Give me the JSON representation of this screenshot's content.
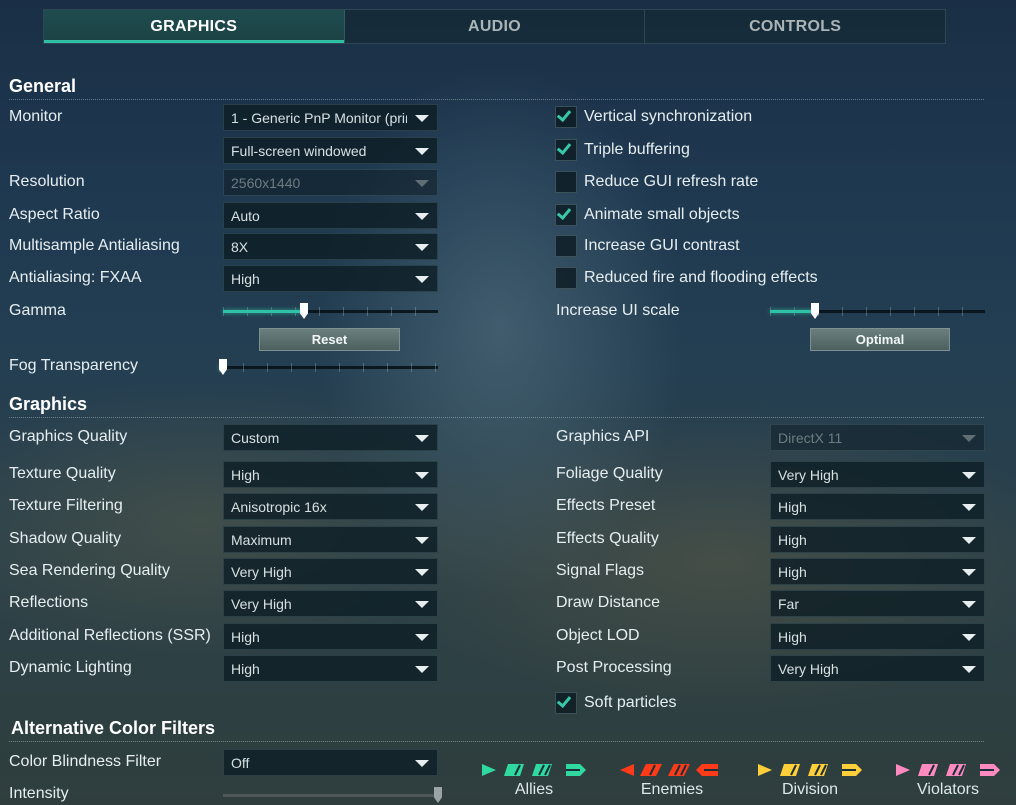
{
  "tabs": [
    {
      "label": "GRAPHICS",
      "active": true
    },
    {
      "label": "AUDIO",
      "active": false
    },
    {
      "label": "CONTROLS",
      "active": false
    }
  ],
  "general": {
    "heading": "General",
    "monitor_label": "Monitor",
    "monitor_value": "1 - Generic PnP Monitor (prim",
    "mode_value": "Full-screen windowed",
    "resolution_label": "Resolution",
    "resolution_value": "2560x1440",
    "aspect_label": "Aspect Ratio",
    "aspect_value": "Auto",
    "msaa_label": "Multisample Antialiasing",
    "msaa_value": "8X",
    "fxaa_label": "Antialiasing: FXAA",
    "fxaa_value": "High",
    "gamma_label": "Gamma",
    "gamma_level": 0.37,
    "reset_label": "Reset",
    "fog_label": "Fog Transparency",
    "fog_level": 0.0,
    "checkboxes": [
      {
        "label": "Vertical synchronization",
        "checked": true
      },
      {
        "label": "Triple buffering",
        "checked": true
      },
      {
        "label": "Reduce GUI refresh rate",
        "checked": false
      },
      {
        "label": "Animate small objects",
        "checked": true
      },
      {
        "label": "Increase GUI contrast",
        "checked": false
      },
      {
        "label": "Reduced fire and flooding effects",
        "checked": false
      }
    ],
    "ui_scale_label": "Increase UI scale",
    "ui_scale_level": 0.2,
    "optimal_label": "Optimal"
  },
  "graphics": {
    "heading": "Graphics",
    "left": [
      {
        "label": "Graphics Quality",
        "value": "Custom"
      },
      {
        "label": "Texture Quality",
        "value": "High"
      },
      {
        "label": "Texture Filtering",
        "value": "Anisotropic 16x"
      },
      {
        "label": "Shadow Quality",
        "value": "Maximum"
      },
      {
        "label": "Sea Rendering Quality",
        "value": "Very High"
      },
      {
        "label": "Reflections",
        "value": "Very High"
      },
      {
        "label": "Additional Reflections (SSR)",
        "value": "High"
      },
      {
        "label": "Dynamic Lighting",
        "value": "High"
      }
    ],
    "right": [
      {
        "label": "Graphics API",
        "value": "DirectX 11"
      },
      {
        "label": "Foliage Quality",
        "value": "Very High"
      },
      {
        "label": "Effects Preset",
        "value": "High"
      },
      {
        "label": "Effects Quality",
        "value": "High"
      },
      {
        "label": "Signal Flags",
        "value": "High"
      },
      {
        "label": "Draw Distance",
        "value": "Far"
      },
      {
        "label": "Object LOD",
        "value": "High"
      },
      {
        "label": "Post Processing",
        "value": "Very High"
      }
    ],
    "soft_particles_label": "Soft particles",
    "soft_particles_checked": true
  },
  "color_filters": {
    "heading": "Alternative Color Filters",
    "filter_label": "Color Blindness Filter",
    "filter_value": "Off",
    "intensity_label": "Intensity",
    "intensity_level": 1.0,
    "groups": [
      {
        "label": "Allies",
        "color": "#2fd9a0"
      },
      {
        "label": "Enemies",
        "color": "#ff3a18"
      },
      {
        "label": "Division",
        "color": "#ffcf3a"
      },
      {
        "label": "Violators",
        "color": "#ff8ac0"
      }
    ]
  },
  "icons": {
    "checkmark": "check-icon",
    "dropdown": "chevron-down-icon",
    "ship_markers": "ship-marker-icon"
  }
}
